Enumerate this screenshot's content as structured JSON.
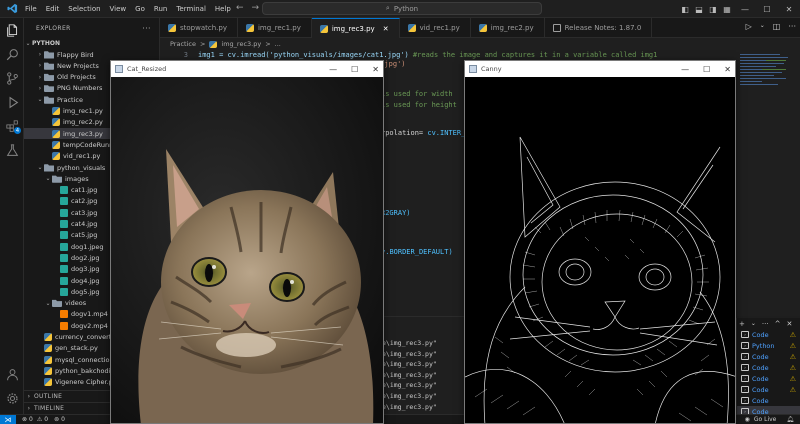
{
  "titlebar": {
    "menus": [
      "File",
      "Edit",
      "Selection",
      "View",
      "Go",
      "Run",
      "Terminal",
      "Help"
    ],
    "search_text": "Python"
  },
  "sidebar": {
    "header": "EXPLORER",
    "root_folder": "PYTHON",
    "items": [
      {
        "label": "Flappy Bird",
        "type": "folder",
        "depth": 1,
        "expanded": false
      },
      {
        "label": "New Projects",
        "type": "folder",
        "depth": 1,
        "expanded": false
      },
      {
        "label": "Old Projects",
        "type": "folder",
        "depth": 1,
        "expanded": false
      },
      {
        "label": "PNG Numbers",
        "type": "folder",
        "depth": 1,
        "expanded": false
      },
      {
        "label": "Practice",
        "type": "folder",
        "depth": 1,
        "expanded": true
      },
      {
        "label": "img_rec1.py",
        "type": "py",
        "depth": 2
      },
      {
        "label": "img_rec2.py",
        "type": "py",
        "depth": 2
      },
      {
        "label": "img_rec3.py",
        "type": "py",
        "depth": 2,
        "selected": true
      },
      {
        "label": "tempCodeRunnerFile.py",
        "type": "py",
        "depth": 2
      },
      {
        "label": "vid_rec1.py",
        "type": "py",
        "depth": 2
      },
      {
        "label": "python_visuals",
        "type": "folder",
        "depth": 1,
        "expanded": true
      },
      {
        "label": "images",
        "type": "folder",
        "depth": 2,
        "expanded": true
      },
      {
        "label": "cat1.jpg",
        "type": "img",
        "depth": 3
      },
      {
        "label": "cat2.jpg",
        "type": "img",
        "depth": 3
      },
      {
        "label": "cat3.jpg",
        "type": "img",
        "depth": 3
      },
      {
        "label": "cat4.jpg",
        "type": "img",
        "depth": 3
      },
      {
        "label": "cat5.jpg",
        "type": "img",
        "depth": 3
      },
      {
        "label": "dog1.jpeg",
        "type": "img",
        "depth": 3
      },
      {
        "label": "dog2.jpg",
        "type": "img",
        "depth": 3
      },
      {
        "label": "dog3.jpg",
        "type": "img",
        "depth": 3
      },
      {
        "label": "dog4.jpg",
        "type": "img",
        "depth": 3
      },
      {
        "label": "dog5.jpg",
        "type": "img",
        "depth": 3
      },
      {
        "label": "videos",
        "type": "folder",
        "depth": 2,
        "expanded": true
      },
      {
        "label": "dogv1.mp4",
        "type": "vid",
        "depth": 3
      },
      {
        "label": "dogv2.mp4",
        "type": "vid",
        "depth": 3
      },
      {
        "label": "currency_converter.py",
        "type": "py",
        "depth": 1
      },
      {
        "label": "gen_stack.py",
        "type": "py",
        "depth": 1
      },
      {
        "label": "mysql_connection.py",
        "type": "py",
        "depth": 1
      },
      {
        "label": "python_bakchodi.py",
        "type": "py",
        "depth": 1
      },
      {
        "label": "Vigenere Cipher.py",
        "type": "py",
        "depth": 1
      }
    ],
    "outline": "OUTLINE",
    "timeline": "TIMELINE"
  },
  "tabs": [
    {
      "label": "stopwatch.py",
      "kind": "py"
    },
    {
      "label": "img_rec1.py",
      "kind": "py"
    },
    {
      "label": "img_rec3.py",
      "kind": "py",
      "active": true
    },
    {
      "label": "vid_rec1.py",
      "kind": "py"
    },
    {
      "label": "img_rec2.py",
      "kind": "py"
    },
    {
      "label": "Release Notes: 1.87.0",
      "kind": "rel"
    }
  ],
  "breadcrumb": {
    "folder": "Practice",
    "sep": ">",
    "file": "img_rec3.py",
    "more": "..."
  },
  "editor": {
    "line3_num": "3",
    "line3_code": "img1 = cv.imread('python_visuals/images/cat1.jpg')",
    "line3_comment": " #reads the image and captures it in a variable called img1",
    "frag_line4": "3.jpg')",
    "frag_width": "is used for width",
    "frag_height": "is used for height",
    "frag_interp_a": "rpolation= ",
    "frag_interp_b": "cv.INTER_",
    "frag_gray": "R2GRAY)",
    "frag_border_a": "v.",
    "frag_border_b": "BORDER_DEFAULT)"
  },
  "terminal": {
    "lines": [
      "e\\img_rec3.py\"",
      "e\\img_rec3.py\"",
      "e\\img_rec3.py\"",
      "e\\img_rec3.py\"",
      "e\\img_rec3.py\"",
      "e\\img_rec3.py\"",
      "e\\img_rec3.py\""
    ],
    "sessions": [
      {
        "label": "Code",
        "warn": true
      },
      {
        "label": "Python",
        "warn": true
      },
      {
        "label": "Code",
        "warn": true
      },
      {
        "label": "Code",
        "warn": true
      },
      {
        "label": "Code",
        "warn": true
      },
      {
        "label": "Code",
        "warn": true
      },
      {
        "label": "Code",
        "warn": false
      },
      {
        "label": "Code",
        "warn": false,
        "selected": true
      }
    ]
  },
  "status": {
    "errors": "0",
    "warnings": "0",
    "ports": "0",
    "golive": "Go Live"
  },
  "windows": {
    "resized": {
      "title": "Cat_Resized"
    },
    "canny": {
      "title": "Canny"
    }
  },
  "colors": {
    "accent": "#0078d4",
    "background": "#1f1f1f",
    "sidebar": "#181818"
  }
}
